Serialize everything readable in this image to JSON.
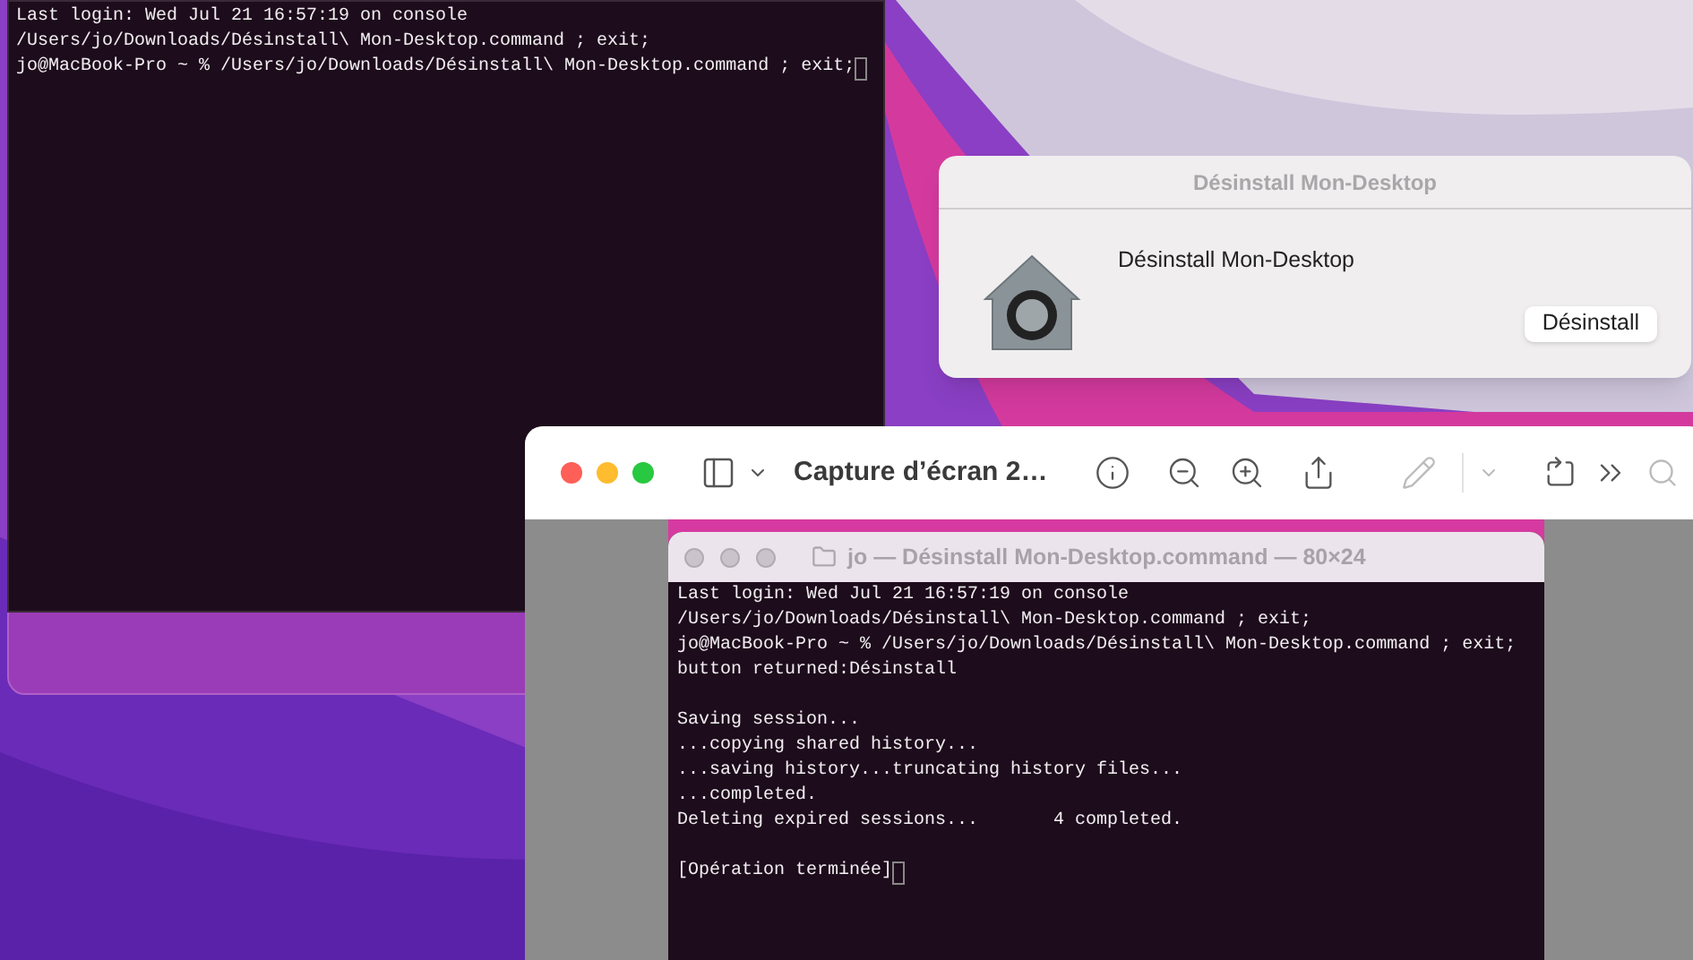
{
  "back_terminal": {
    "blocks": [
      [
        "Last login: Wed Jul 21 16:57:19 on console",
        "/Users/jo/Downloads/Désinstall\\ Mon-Desktop.command ; exit;",
        "jo@MacBook-Pro ~ % /Users/jo/Downloads/Désinstall\\ Mon-Desktop.command ; exit;"
      ]
    ],
    "cursor": true
  },
  "dialog": {
    "title": "Désinstall Mon-Desktop",
    "message": "Désinstall Mon-Desktop",
    "button": "Désinstall"
  },
  "preview": {
    "title": "Capture d’écran 2…",
    "screenshot": {
      "terminal_title": "jo — Désinstall Mon-Desktop.command — 80×24",
      "cursor": true,
      "blocks": [
        [
          "Last login: Wed Jul 21 16:57:19 on console",
          "/Users/jo/Downloads/Désinstall\\ Mon-Desktop.command ; exit;",
          "jo@MacBook-Pro ~ % /Users/jo/Downloads/Désinstall\\ Mon-Desktop.command ; exit;",
          "button returned:Désinstall"
        ],
        [
          "Saving session...",
          "...copying shared history...",
          "...saving history...truncating history files...",
          "...completed.",
          "Deleting expired sessions...       4 completed."
        ],
        [
          "[Opération terminée]"
        ]
      ]
    }
  }
}
